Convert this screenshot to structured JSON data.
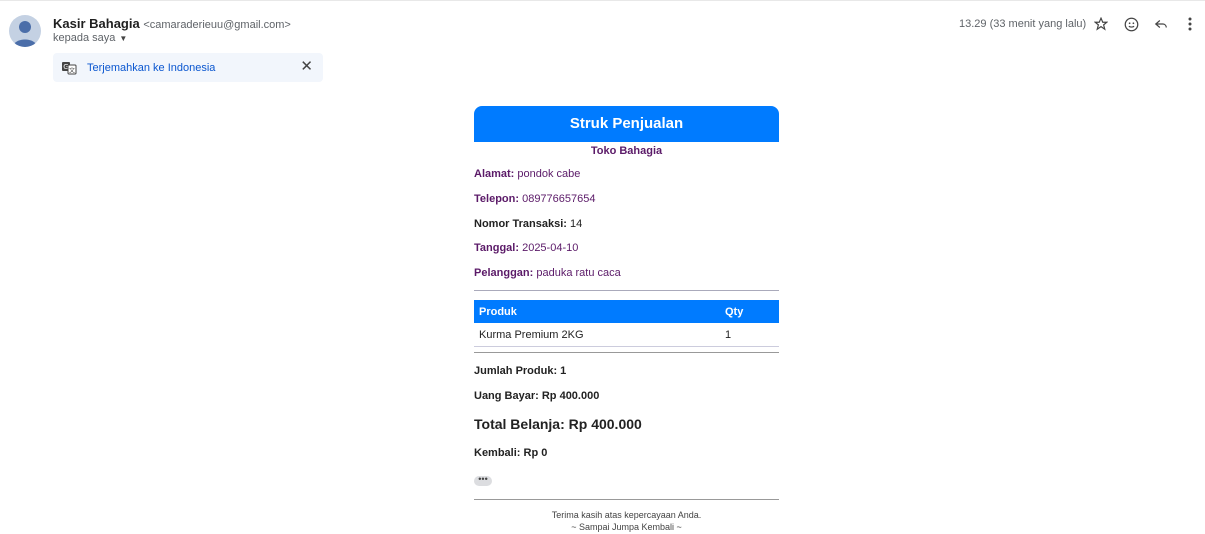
{
  "email": {
    "sender_name": "Kasir Bahagia",
    "sender_email": "<camaraderieuu@gmail.com>",
    "to_label": "kepada saya",
    "timestamp": "13.29 (33 menit yang lalu)",
    "translate_label": "Terjemahkan ke Indonesia"
  },
  "icons": {
    "translate": "translate-icon",
    "close": "close-icon",
    "star": "star-icon",
    "emoji": "emoji-icon",
    "reply": "reply-icon",
    "more": "more-vert-icon"
  },
  "colors": {
    "accent": "#007bff",
    "label_purple": "#5b1a68",
    "link": "#0b57d0"
  },
  "receipt": {
    "title": "Struk Penjualan",
    "store_name": "Toko Bahagia",
    "address_label": "Alamat:",
    "address_value": "pondok cabe",
    "phone_label": "Telepon:",
    "phone_value": "089776657654",
    "trx_label": "Nomor Transaksi:",
    "trx_value": "14",
    "date_label": "Tanggal:",
    "date_value": "2025-04-10",
    "customer_label": "Pelanggan:",
    "customer_value": "paduka ratu caca",
    "table_headers": [
      "Produk",
      "Qty"
    ],
    "table_rows": [
      {
        "product": "Kurma Premium 2KG",
        "qty": "1"
      }
    ],
    "jumlah_produk": "Jumlah Produk: 1",
    "uang_bayar": "Uang Bayar: Rp 400.000",
    "total_belanja": "Total Belanja: Rp 400.000",
    "kembali": "Kembali: Rp 0",
    "more_label": "•••",
    "footer_line1": "Terima kasih atas kepercayaan Anda.",
    "footer_line2": "~ Sampai Jumpa Kembali ~"
  }
}
